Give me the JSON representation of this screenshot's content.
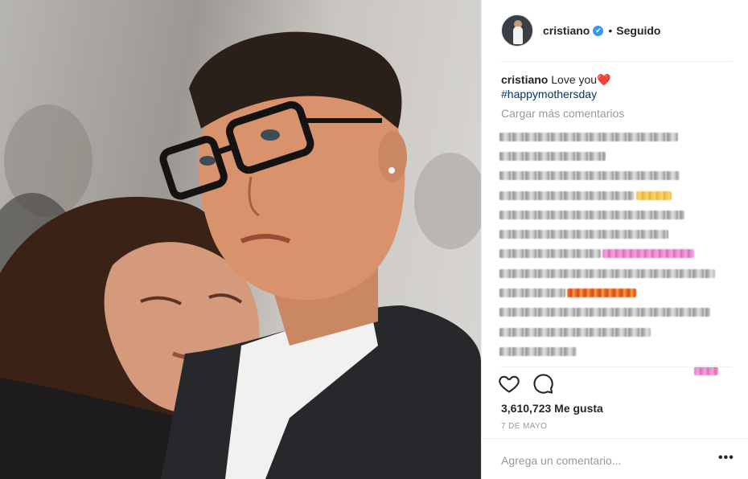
{
  "post": {
    "username": "cristiano",
    "verified_mark": "✔",
    "dot": "•",
    "follow_status": "Seguido",
    "caption_user": "cristiano",
    "caption_text": "Love you",
    "caption_emoji": "❤️",
    "hashtag": "#happymothersday",
    "load_more": "Cargar más comentarios",
    "likes": "3,610,723 Me gusta",
    "date": "7 DE MAYO",
    "add_comment_placeholder": "Agrega un comentario...",
    "options": "•••"
  },
  "icons": {
    "like": "heart-outline-icon",
    "comment": "speech-bubble-icon",
    "verified": "verified-badge-icon",
    "options": "more-options-icon"
  },
  "colors": {
    "link": "#003569",
    "muted": "#999999",
    "verified": "#3897f0",
    "heart": "#e0245e"
  }
}
